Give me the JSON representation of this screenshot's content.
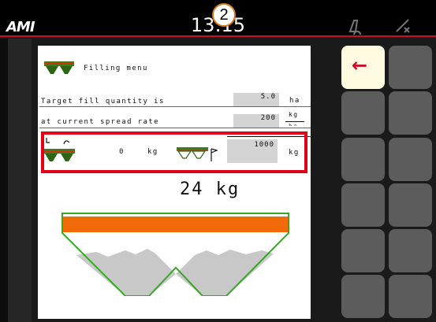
{
  "topbar": {
    "logo": "AMI",
    "clock": "13:15",
    "callout_number": "2",
    "icons": [
      "machine-icon",
      "gps-icon"
    ]
  },
  "screen": {
    "title": "Filling menu",
    "target_fill_label": "Target fill quantity is",
    "target_fill_value": "5.0",
    "target_fill_unit": "ha",
    "spread_rate_label": "at current spread rate",
    "spread_rate_value": "200",
    "spread_rate_unit_top": "kg",
    "spread_rate_unit_bottom": "ha",
    "current_load_value": "0",
    "current_load_unit": "kg",
    "fill_field_value": "1000",
    "fill_field_unit": "kg",
    "hopper_weight": "24 kg"
  },
  "colors": {
    "accent_red": "#e3001b",
    "spreader_green": "#3a7d1e",
    "hopper_orange": "#f06a0a",
    "hopper_outline": "#3aa629"
  },
  "softkeys": {
    "back_icon": "arrow-left-icon"
  }
}
